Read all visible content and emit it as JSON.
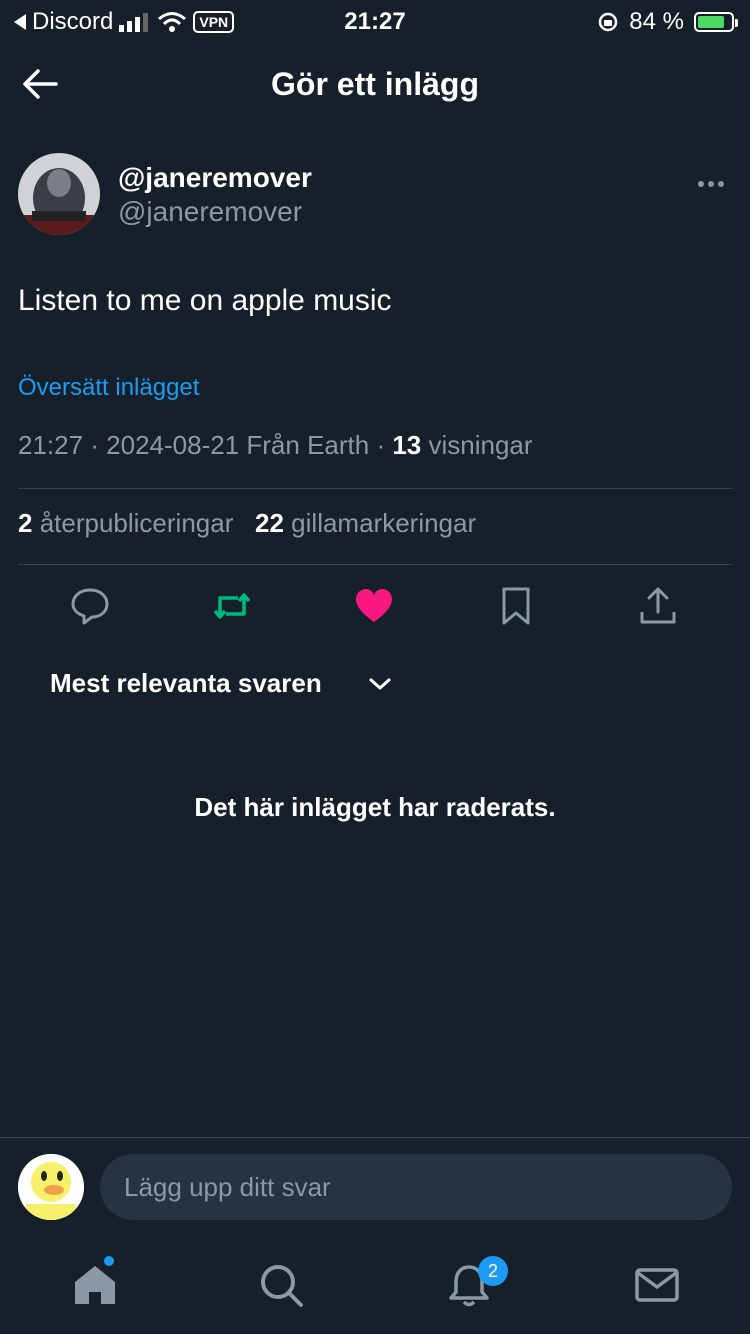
{
  "status_bar": {
    "back_app": "Discord",
    "vpn": "VPN",
    "time": "21:27",
    "battery": "84 %"
  },
  "header": {
    "title": "Gör ett inlägg"
  },
  "post": {
    "author_name": "@janeremover",
    "author_handle": "@janeremover",
    "text": "Listen to me on apple music",
    "translate_label": "Översätt inlägget",
    "meta_prefix": "21:27 · 2024-08-21 Från Earth · ",
    "views_count": "13",
    "views_label": " visningar",
    "reposts_count": "2",
    "reposts_label": " återpubliceringar",
    "likes_count": "22",
    "likes_label": " gillamarkeringar"
  },
  "replies": {
    "sort_label": "Mest relevanta svaren",
    "deleted_message": "Det här inlägget har raderats."
  },
  "reply_box": {
    "placeholder": "Lägg upp ditt svar"
  },
  "bottom_nav": {
    "notifications_badge": "2"
  },
  "colors": {
    "background": "#15202b",
    "accent": "#1d9bf0",
    "retweet": "#00ba7c",
    "like": "#f91880",
    "muted": "#8b98a5"
  }
}
